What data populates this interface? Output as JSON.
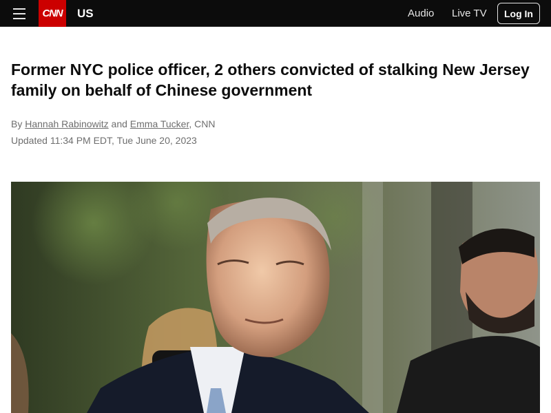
{
  "header": {
    "menu_icon": "hamburger-menu-icon",
    "logo_text": "CNN",
    "section": "US",
    "nav": {
      "audio": "Audio",
      "live_tv": "Live TV"
    },
    "login_label": "Log In",
    "colors": {
      "bar": "#0c0c0c",
      "brand": "#cc0000"
    }
  },
  "article": {
    "headline": "Former NYC police officer, 2 others convicted of stalking New Jersey family on behalf of Chinese government",
    "byline": {
      "prefix": "By",
      "author1": "Hannah Rabinowitz",
      "joiner": "and",
      "author2": "Emma Tucker",
      "suffix": ", CNN"
    },
    "updated": "Updated 11:34 PM EDT, Tue June 20, 2023"
  }
}
